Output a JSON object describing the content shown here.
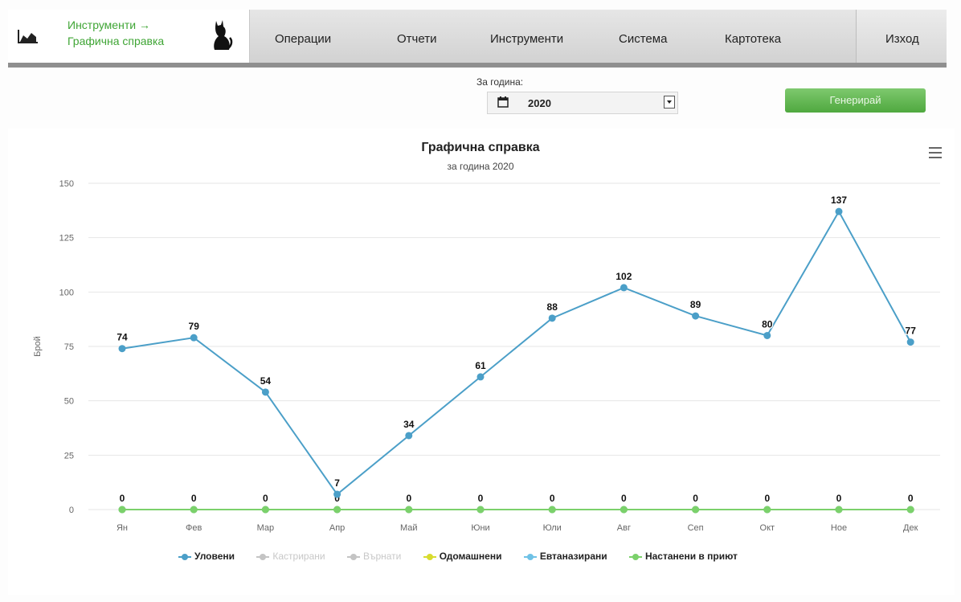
{
  "nav": {
    "brand_line1": "Инструменти →",
    "brand_line2": "Графична справка",
    "menu": [
      "Операции",
      "Отчети",
      "Инструменти",
      "Система",
      "Картотека"
    ],
    "logout": "Изход"
  },
  "filter": {
    "year_label": "За година:",
    "year_value": "2020",
    "generate_label": "Генерирай"
  },
  "colors": {
    "series_main": "#4b9fc8",
    "series_zero": "#7bd16b",
    "accent_green": "#3fa535"
  },
  "chart_data": {
    "type": "line",
    "title": "Графична справка",
    "subtitle": "за година 2020",
    "ylabel": "Брой",
    "xlabel": "",
    "ylim": [
      0,
      150
    ],
    "yticks": [
      0,
      25,
      50,
      75,
      100,
      125,
      150
    ],
    "categories": [
      "Ян",
      "Фев",
      "Мар",
      "Апр",
      "Май",
      "Юни",
      "Юли",
      "Авг",
      "Сеп",
      "Окт",
      "Ное",
      "Дек"
    ],
    "series": [
      {
        "name": "Уловени",
        "visible": true,
        "color": "#4b9fc8",
        "values": [
          74,
          79,
          54,
          7,
          34,
          61,
          88,
          102,
          89,
          80,
          137,
          77
        ]
      },
      {
        "name": "Кастрирани",
        "visible": false,
        "values": []
      },
      {
        "name": "Върнати",
        "visible": false,
        "values": []
      },
      {
        "name": "Одомашнени",
        "visible": true,
        "color": "#d8dc2e",
        "values": [
          0,
          0,
          0,
          0,
          0,
          0,
          0,
          0,
          0,
          0,
          0,
          0
        ]
      },
      {
        "name": "Евтаназирани",
        "visible": true,
        "color": "#6fc2e6",
        "values": [
          0,
          0,
          0,
          0,
          0,
          0,
          0,
          0,
          0,
          0,
          0,
          0
        ]
      },
      {
        "name": "Настанени в приют",
        "visible": true,
        "color": "#7bd16b",
        "values": [
          0,
          0,
          0,
          0,
          0,
          0,
          0,
          0,
          0,
          0,
          0,
          0
        ]
      }
    ],
    "grid": true,
    "legend_position": "bottom"
  }
}
